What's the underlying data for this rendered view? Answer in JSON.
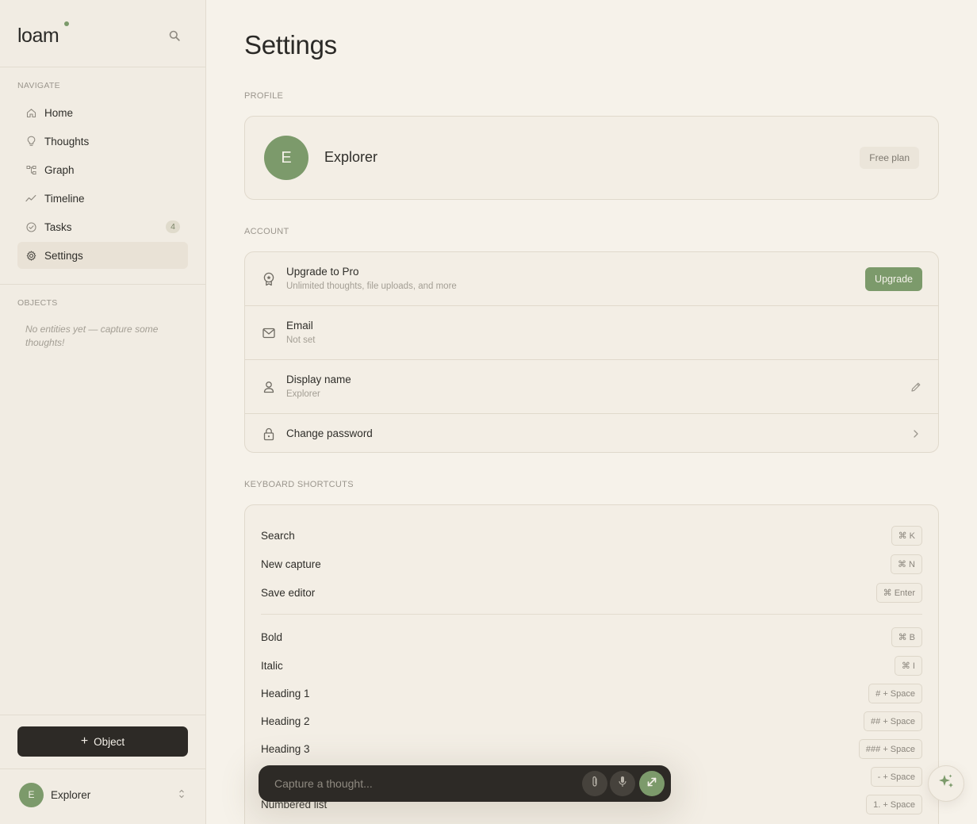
{
  "brand": {
    "name": "loam"
  },
  "sidebar": {
    "navigate_title": "NAVIGATE",
    "items": [
      {
        "label": "Home",
        "icon": "home-icon"
      },
      {
        "label": "Thoughts",
        "icon": "lightbulb-icon"
      },
      {
        "label": "Graph",
        "icon": "graph-icon"
      },
      {
        "label": "Timeline",
        "icon": "timeline-icon"
      },
      {
        "label": "Tasks",
        "icon": "check-circle-icon",
        "badge": "4"
      },
      {
        "label": "Settings",
        "icon": "gear-icon",
        "active": true
      }
    ],
    "objects_title": "OBJECTS",
    "objects_empty": "No entities yet — capture some thoughts!",
    "object_button": "Object",
    "user": {
      "initial": "E",
      "name": "Explorer"
    }
  },
  "page": {
    "title": "Settings"
  },
  "profile": {
    "section": "PROFILE",
    "initial": "E",
    "name": "Explorer",
    "plan": "Free plan"
  },
  "account": {
    "section": "ACCOUNT",
    "upgrade": {
      "title": "Upgrade to Pro",
      "subtitle": "Unlimited thoughts, file uploads, and more",
      "button": "Upgrade"
    },
    "email": {
      "title": "Email",
      "subtitle": "Not set"
    },
    "display_name": {
      "title": "Display name",
      "subtitle": "Explorer"
    },
    "password": {
      "title": "Change password"
    }
  },
  "shortcuts": {
    "section": "KEYBOARD SHORTCUTS",
    "group1": [
      {
        "label": "Search",
        "key": "⌘ K"
      },
      {
        "label": "New capture",
        "key": "⌘ N"
      },
      {
        "label": "Save editor",
        "key": "⌘ Enter"
      }
    ],
    "group2": [
      {
        "label": "Bold",
        "key": "⌘ B"
      },
      {
        "label": "Italic",
        "key": "⌘ I"
      },
      {
        "label": "Heading 1",
        "key": "# + Space"
      },
      {
        "label": "Heading 2",
        "key": "## + Space"
      },
      {
        "label": "Heading 3",
        "key": "### + Space"
      },
      {
        "label": "",
        "key": "- + Space"
      },
      {
        "label": "Numbered list",
        "key": "1. + Space"
      }
    ]
  },
  "capture": {
    "placeholder": "Capture a thought..."
  },
  "colors": {
    "accent": "#7c9a6b",
    "dark": "#2d2a26",
    "background": "#f6f2ea",
    "sidebar": "#f1ece3"
  }
}
